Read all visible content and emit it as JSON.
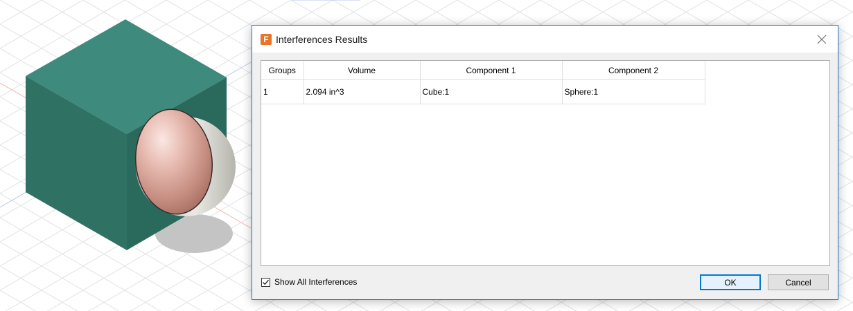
{
  "dialog": {
    "title": "Interferences Results",
    "close_icon": "close-icon",
    "app_icon": {
      "glyph": "F",
      "color": "#e8742a"
    },
    "table": {
      "columns": [
        "Groups",
        "Volume",
        "Component 1",
        "Component 2"
      ],
      "rows": [
        {
          "group": "1",
          "volume": "2.094 in^3",
          "component1": "Cube:1",
          "component2": "Sphere:1"
        }
      ]
    },
    "show_all_label": "Show All Interferences",
    "show_all_checked": true,
    "ok_label": "OK",
    "cancel_label": "Cancel"
  },
  "colors": {
    "accent": "#0078d7",
    "cube": "#2e7466",
    "sphere": "#e0b0a4"
  }
}
